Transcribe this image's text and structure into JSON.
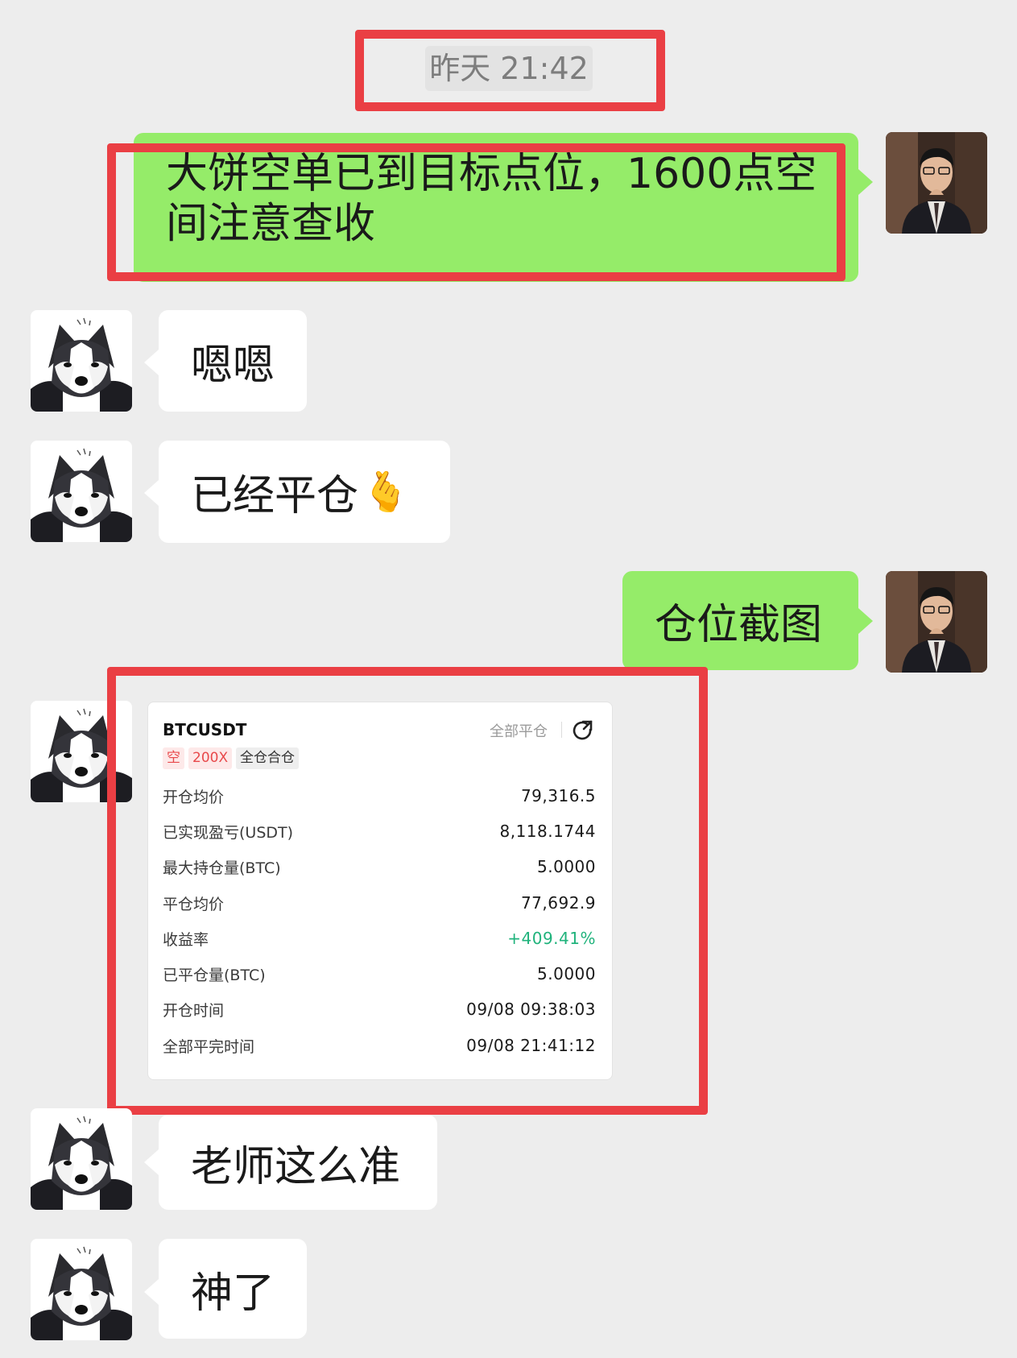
{
  "timestamp": "昨天 21:42",
  "messages": {
    "m1": "大饼空单已到目标点位，1600点空间注意查收",
    "m2": "嗯嗯",
    "m3": "已经平仓",
    "m3_emoji": "🫰",
    "m4": "仓位截图",
    "m5": "老师这么准",
    "m6": "神了"
  },
  "card": {
    "symbol": "BTCUSDT",
    "close_all": "全部平仓",
    "tag_side": "空",
    "tag_leverage": "200X",
    "tag_mode": "全仓合仓",
    "rows": [
      {
        "label": "开仓均价",
        "value": "79,316.5"
      },
      {
        "label": "已实现盈亏(USDT)",
        "value": "8,118.1744"
      },
      {
        "label": "最大持仓量(BTC)",
        "value": "5.0000"
      },
      {
        "label": "平仓均价",
        "value": "77,692.9"
      },
      {
        "label": "收益率",
        "value": "+409.41%"
      },
      {
        "label": "已平仓量(BTC)",
        "value": "5.0000"
      },
      {
        "label": "开仓时间",
        "value": "09/08 09:38:03"
      },
      {
        "label": "全部平完时间",
        "value": "09/08 21:41:12"
      }
    ]
  },
  "colors": {
    "background": "#ededed",
    "sent_bubble": "#95ec69",
    "received_bubble": "#ffffff",
    "highlight_box": "#ea3f44",
    "tag_red": "#e8494b",
    "profit_green": "#20b37c"
  },
  "icons": {
    "share": "share-icon",
    "dog_avatar": "husky-avatar",
    "man_avatar": "teacher-avatar"
  }
}
